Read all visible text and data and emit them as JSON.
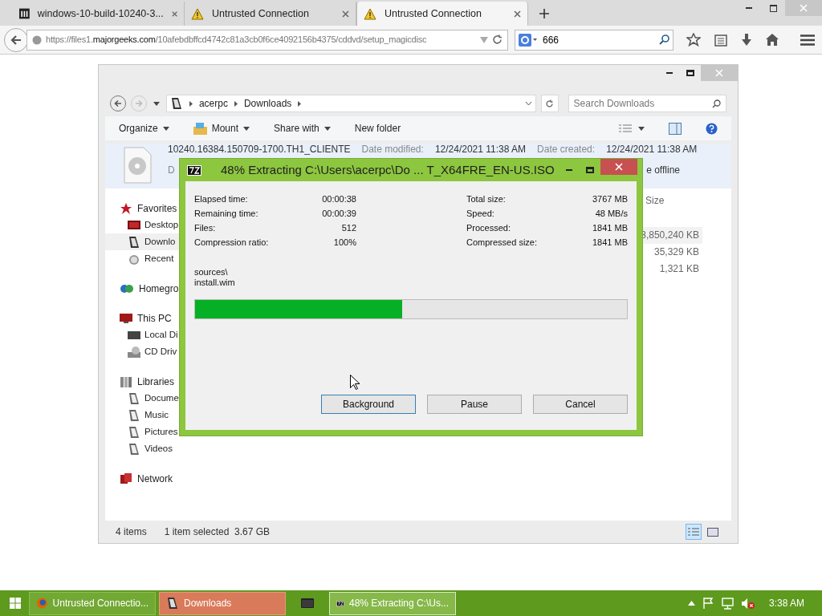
{
  "browser": {
    "tabs": [
      {
        "title": "windows-10-build-10240-3...",
        "kind": "site",
        "selected": false
      },
      {
        "title": "Untrusted Connection",
        "kind": "warning",
        "selected": false
      },
      {
        "title": "Untrusted Connection",
        "kind": "warning",
        "selected": true
      }
    ],
    "url": [
      {
        "text": "https://files1.",
        "strong": false
      },
      {
        "text": "majorgeeks.com",
        "strong": true
      },
      {
        "text": "/10afebdbffcd4742c81a3cb0f6ce4092156b4375/cddvd/setup_magicdisc",
        "strong": false
      }
    ],
    "search_value": "666"
  },
  "explorer": {
    "breadcrumb": [
      "acerpc",
      "Downloads"
    ],
    "search_placeholder": "Search Downloads",
    "commands": [
      {
        "label": "Organize",
        "kind": "plain",
        "dropdown": true
      },
      {
        "label": "Mount",
        "kind": "drive",
        "dropdown": true
      },
      {
        "label": "Share with",
        "kind": "plain",
        "dropdown": true
      },
      {
        "label": "New folder",
        "kind": "plain",
        "dropdown": false
      }
    ],
    "file": {
      "name": "10240.16384.150709-1700.TH1_CLIENTE",
      "modified_label": "Date modified:",
      "modified": "12/24/2021 11:38 AM",
      "created_label": "Date created:",
      "created": "12/24/2021 11:38 AM",
      "line2_left": "D",
      "line2_right": "e offline"
    },
    "size_header": "Size",
    "sizes": [
      {
        "text": "3,850,240 KB",
        "selected": true
      },
      {
        "text": "35,329 KB",
        "selected": false
      },
      {
        "text": "1,321 KB",
        "selected": false
      }
    ],
    "nav": [
      {
        "label": "Favorites",
        "kind": "star",
        "children": [
          {
            "label": "Desktop",
            "kind": "desktop",
            "selected": false
          },
          {
            "label": "Downlo",
            "kind": "downloads",
            "selected": true
          },
          {
            "label": "Recent",
            "kind": "recent",
            "selected": false
          }
        ]
      },
      {
        "label": "Homegro",
        "kind": "homegroup"
      },
      {
        "label": "This PC",
        "kind": "pc",
        "children": [
          {
            "label": "Local Di",
            "kind": "disk",
            "selected": false
          },
          {
            "label": "CD Driv",
            "kind": "cd",
            "selected": false
          }
        ]
      },
      {
        "label": "Libraries",
        "kind": "libraries",
        "children": [
          {
            "label": "Docume",
            "kind": "lib",
            "selected": false
          },
          {
            "label": "Music",
            "kind": "lib",
            "selected": false
          },
          {
            "label": "Pictures",
            "kind": "lib",
            "selected": false
          },
          {
            "label": "Videos",
            "kind": "lib",
            "selected": false
          }
        ]
      },
      {
        "label": "Network",
        "kind": "network"
      }
    ],
    "status": [
      "4 items",
      "1 item selected  3.67 GB"
    ],
    "details_view": true
  },
  "dialog": {
    "title": "48% Extracting C:\\Users\\acerpc\\Do ... T_X64FRE_EN-US.ISO",
    "stats_left": [
      {
        "label": "Elapsed time:",
        "value": "00:00:38"
      },
      {
        "label": "Remaining time:",
        "value": "00:00:39"
      },
      {
        "label": "Files:",
        "value": "512"
      },
      {
        "label": "Compression ratio:",
        "value": "100%"
      }
    ],
    "stats_right": [
      {
        "label": "Total size:",
        "value": "3767 MB"
      },
      {
        "label": "Speed:",
        "value": "48 MB/s"
      },
      {
        "label": "Processed:",
        "value": "1841 MB"
      },
      {
        "label": "Compressed size:",
        "value": "1841 MB"
      }
    ],
    "current": [
      "sources\\",
      "install.wim"
    ],
    "progress": {
      "level": 0.48
    },
    "buttons": [
      {
        "label": "Background",
        "focused": true
      },
      {
        "label": "Pause",
        "focused": false
      },
      {
        "label": "Cancel",
        "focused": false
      }
    ]
  },
  "taskbar": {
    "items": [
      {
        "label": "Untrusted Connectio...",
        "kind": "firefox",
        "selected": false,
        "highlighted": false
      },
      {
        "label": "Downloads",
        "kind": "explorer",
        "selected": false,
        "highlighted": true
      },
      {
        "kind": "console",
        "selected": false,
        "highlighted": false
      },
      {
        "label": "48% Extracting C:\\Us...",
        "kind": "archive",
        "selected": true,
        "highlighted": false
      }
    ],
    "clock": "3:38 AM"
  }
}
